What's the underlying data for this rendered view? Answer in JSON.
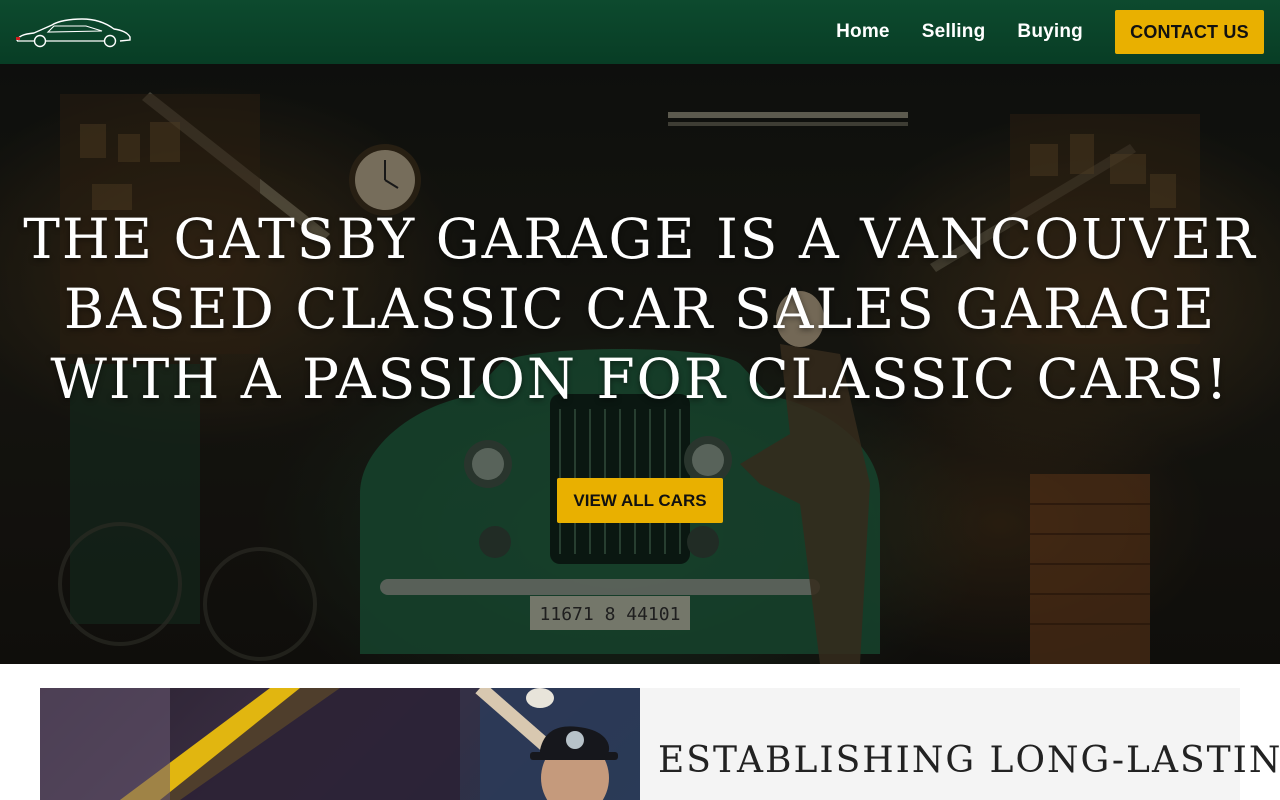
{
  "header": {
    "logo_icon": "classic-car-logo-icon",
    "nav": {
      "home": "Home",
      "selling": "Selling",
      "buying": "Buying",
      "contact": "CONTACT US"
    }
  },
  "hero": {
    "title": "THE GATSBY GARAGE IS A VANCOUVER BASED CLASSIC CAR SALES GARAGE WITH A PASSION FOR CLASSIC CARS!",
    "cta": "VIEW ALL CARS",
    "plate": "11671 8 44101"
  },
  "feature": {
    "heading": "ESTABLISHING LONG-LASTING"
  },
  "colors": {
    "header_bg": "#0b4529",
    "accent": "#e9b000",
    "panel_bg": "#f4f4f4"
  }
}
